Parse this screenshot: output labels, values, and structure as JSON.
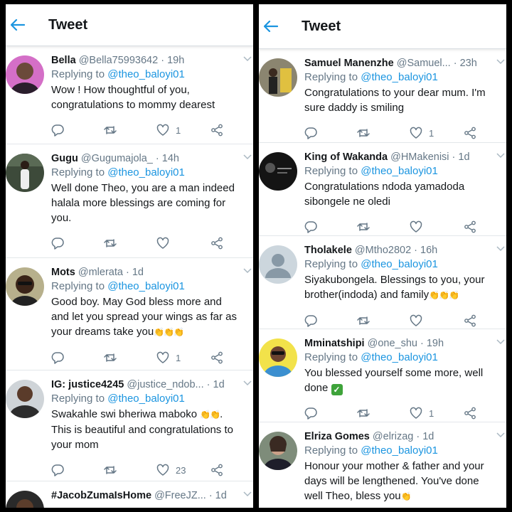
{
  "header": {
    "title": "Tweet"
  },
  "left_tweets": [
    {
      "name": "Bella",
      "handle": "@Bella75993642",
      "time": "· 19h",
      "replying_prefix": "Replying to ",
      "replying_to": "@theo_baloyi01",
      "text": "Wow ! How thoughtful of you, congratulations to mommy dearest",
      "likes": "1"
    },
    {
      "name": "Gugu",
      "handle": "@Gugumajola_",
      "time": "· 14h",
      "replying_prefix": "Replying to ",
      "replying_to": "@theo_baloyi01",
      "text": "Well done Theo, you are a man indeed halala more blessings are coming for you.",
      "likes": ""
    },
    {
      "name": "Mots",
      "handle": "@mlerata",
      "time": "· 1d",
      "replying_prefix": "Replying to ",
      "replying_to": "@theo_baloyi01",
      "text": "Good boy. May God bless more and and let you spread your wings as far as your dreams take you",
      "emoji": "👏👏👏",
      "likes": "1"
    },
    {
      "name": "IG: justice4245",
      "handle": "@justice_ndob...",
      "time": "· 1d",
      "replying_prefix": "Replying to ",
      "replying_to": "@theo_baloyi01",
      "text_before": "Swakahle swi bheriwa maboko ",
      "emoji": "👏👏",
      "text_after": ". This is beautiful and congratulations to your mom",
      "likes": "23"
    },
    {
      "name": "#JacobZumaIsHome",
      "handle": "@FreeJZ...",
      "time": "· 1d"
    }
  ],
  "right_tweets": [
    {
      "name": "Samuel Manenzhe",
      "handle": "@Samuel...",
      "time": "· 23h",
      "replying_prefix": "Replying to ",
      "replying_to": "@theo_baloyi01",
      "text": "Congratulations to your dear mum. I'm sure daddy is smiling",
      "likes": "1"
    },
    {
      "name": "King of Wakanda",
      "handle": "@HMakenisi",
      "time": "· 1d",
      "replying_prefix": "Replying to ",
      "replying_to": "@theo_baloyi01",
      "text": "Congratulations ndoda yamadoda sibongele ne oledi",
      "likes": ""
    },
    {
      "name": "Tholakele",
      "handle": "@Mtho2802",
      "time": "· 16h",
      "replying_prefix": "Replying to ",
      "replying_to": "@theo_baloyi01",
      "text": "Siyakubongela. Blessings to you, your brother(indoda) and family",
      "emoji": "👏👏👏",
      "likes": ""
    },
    {
      "name": "Mminatshipi",
      "handle": "@one_shu",
      "time": "· 19h",
      "replying_prefix": "Replying to ",
      "replying_to": "@theo_baloyi01",
      "text": "You blessed yourself some more, well done",
      "check": "✓",
      "likes": "1"
    },
    {
      "name": "Elriza Gomes",
      "handle": "@elrizag",
      "time": "· 1d",
      "replying_prefix": "Replying to ",
      "replying_to": "@theo_baloyi01",
      "text": "Honour your mother & father and your days will be lengthened.  You've done well Theo, bless you",
      "emoji": "👏"
    }
  ],
  "icons": {
    "back": "arrow-left-icon",
    "reply": "reply-icon",
    "retweet": "retweet-icon",
    "like": "heart-icon",
    "share": "share-icon",
    "more": "chevron-down-icon"
  },
  "colors": {
    "accent": "#1b95e0",
    "secondary_text": "#657786",
    "clap": "#f5c400",
    "check": "#3ea33a"
  }
}
